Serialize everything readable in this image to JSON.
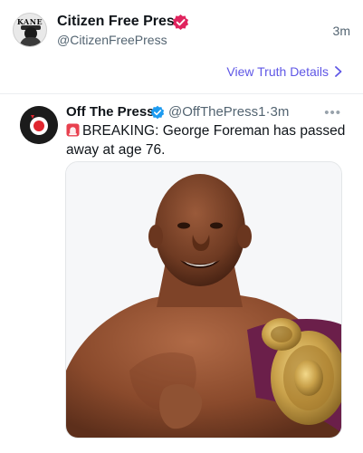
{
  "post": {
    "author_name": "Citizen Free Press",
    "author_handle": "@CitizenFreePress",
    "time": "3m",
    "avatar_text": "KANE",
    "verified_color": "#e0245e"
  },
  "truth_link": {
    "label": "View Truth Details"
  },
  "embed": {
    "author_name": "Off The Press",
    "handle_time": "@OffThePress1·3m",
    "verified_color": "#1d9bf0",
    "text": "BREAKING: George Foreman has passed away at age 76.",
    "image_alt": "photo-of-george-foreman-with-championship-belt"
  },
  "colors": {
    "link": "#5f57e6",
    "secondary_text": "#536471"
  }
}
